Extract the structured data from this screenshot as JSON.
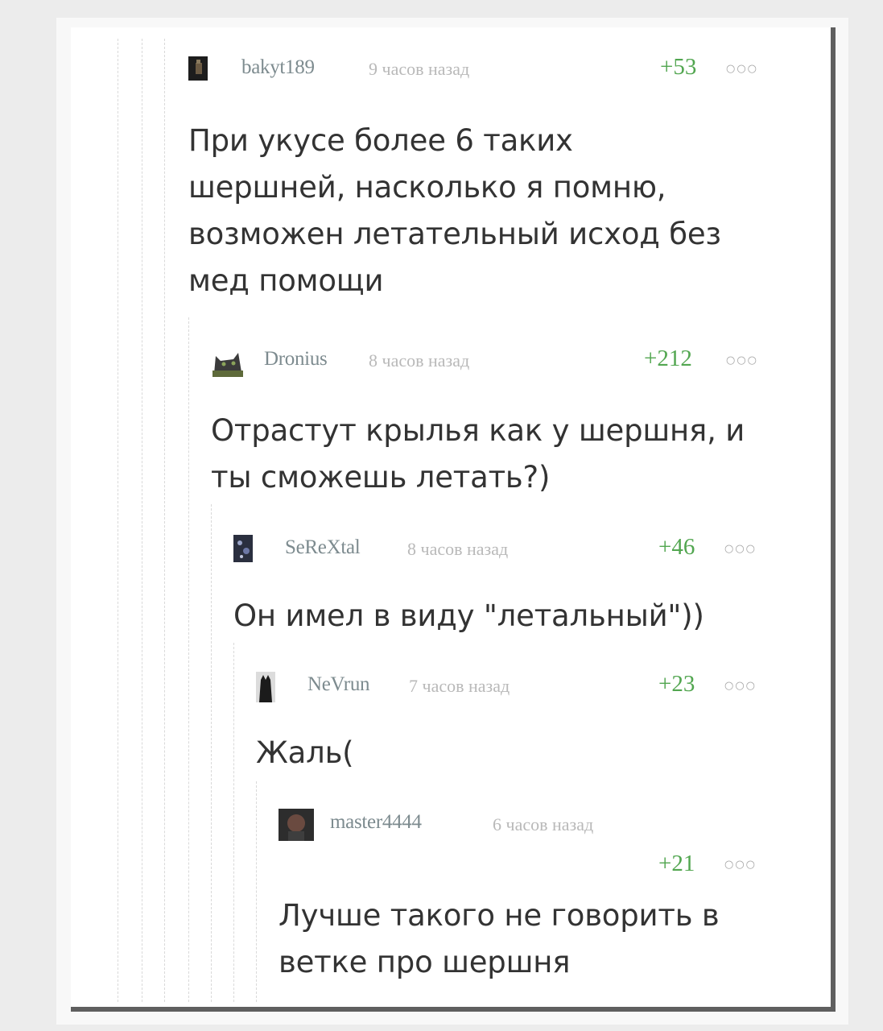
{
  "comments": [
    {
      "username": "bakyt189",
      "time": "9 часов назад",
      "rating": "+53",
      "menu_icon": "more-dots-icon",
      "text_lines": [
        "При укусе более 6 таких",
        "шершней, насколько я помню,",
        "возможен летательный исход без",
        "мед помощи"
      ]
    },
    {
      "username": "Dronius",
      "time": "8 часов назад",
      "rating": "+212",
      "menu_icon": "more-dots-icon",
      "text_lines": [
        "Отрастут крылья как у шершня, и",
        "ты сможешь летать?)"
      ]
    },
    {
      "username": "SeReXtal",
      "time": "8 часов назад",
      "rating": "+46",
      "menu_icon": "more-dots-icon",
      "text_lines": [
        "Он имел в виду \"летальный\"))"
      ]
    },
    {
      "username": "NeVrun",
      "time": "7 часов назад",
      "rating": "+23",
      "menu_icon": "more-dots-icon",
      "text_lines": [
        "Жаль("
      ]
    },
    {
      "username": "master4444",
      "time": "6 часов назад",
      "rating": "+21",
      "menu_icon": "more-dots-icon",
      "text_lines": [
        "Лучше такого не говорить в",
        "ветке про шершня"
      ]
    }
  ],
  "colors": {
    "rating": "#52a650",
    "username": "#7d8b8f",
    "time": "#b9b9b9",
    "text": "#333333"
  }
}
